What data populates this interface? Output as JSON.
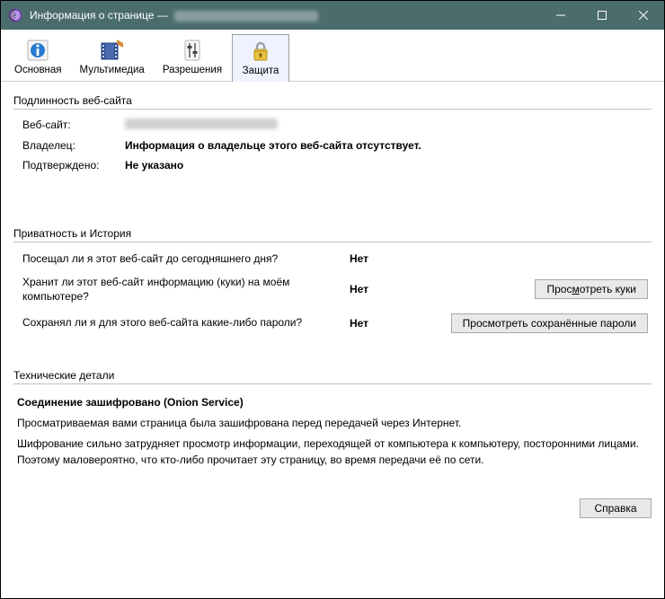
{
  "window": {
    "title_prefix": "Информация о странице — "
  },
  "tabs": {
    "general": "Основная",
    "media": "Мультимедиа",
    "permissions": "Разрешения",
    "security": "Защита"
  },
  "authenticity": {
    "heading": "Подлинность веб-сайта",
    "website_label": "Веб-сайт:",
    "owner_label": "Владелец:",
    "owner_value": "Информация о владельце этого веб-сайта отсутствует.",
    "verified_label": "Подтверждено:",
    "verified_value": "Не указано"
  },
  "privacy": {
    "heading": "Приватность и История",
    "q_visited": "Посещал ли я этот веб-сайт до сегодняшнего дня?",
    "a_visited": "Нет",
    "q_cookies": "Хранит ли этот веб-сайт информацию (куки) на моём компьютере?",
    "a_cookies": "Нет",
    "btn_cookies_pre": "Прос",
    "btn_cookies_u": "м",
    "btn_cookies_post": "отреть куки",
    "q_passwords": "Сохранял ли я для этого веб-сайта какие-либо пароли?",
    "a_passwords": "Нет",
    "btn_passwords": "Просмотреть сохранённые пароли"
  },
  "technical": {
    "heading": "Технические детали",
    "line1": "Соединение зашифровано (Onion Service)",
    "line2": "Просматриваемая вами страница была зашифрована перед передачей через Интернет.",
    "line3": "Шифрование сильно затрудняет просмотр информации, переходящей от компьютера к компьютеру, посторонними лицами. Поэтому маловероятно, что кто-либо прочитает эту страницу, во время передачи её по сети."
  },
  "footer": {
    "help": "Справка"
  }
}
